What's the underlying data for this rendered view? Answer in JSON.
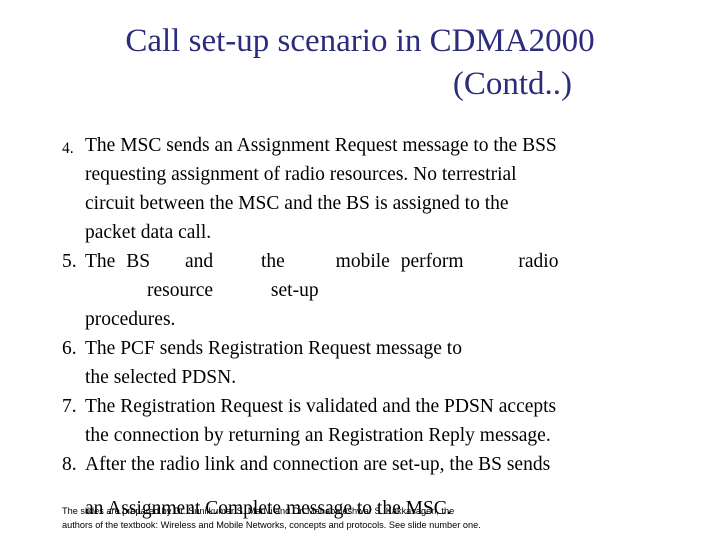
{
  "slide": {
    "title": {
      "line1": "Call set-up scenario in CDMA2000",
      "line2": "(Contd..)",
      "color": "#2c2c7c"
    },
    "items": [
      {
        "marker": "4.",
        "marker_style": "small",
        "lines": [
          "The MSC sends an Assignment Request message to the BSS",
          "requesting assignment of radio resources. No terrestrial",
          "circuit between the MSC and the BS is assigned to the",
          "packet data call."
        ],
        "full_text": "The MSC sends an Assignment Request message to the BSS requesting assignment of radio resources. No terrestrial circuit between the MSC and the BS is assigned to the packet data call."
      },
      {
        "marker": "5.",
        "marker_style": "normal",
        "line1_words": [
          "The",
          "BS",
          "and",
          "the",
          "mobile",
          "perform",
          "radio"
        ],
        "line2_words": [
          "resource",
          "set-up"
        ],
        "line3": "procedures.",
        "full_text": "The BS and the mobile perform radio resource set-up procedures."
      },
      {
        "marker": "6.",
        "marker_style": "normal",
        "lines": [
          "The PCF sends Registration Request message to",
          "the selected PDSN."
        ],
        "full_text": "The PCF sends Registration Request message to the selected PDSN."
      },
      {
        "marker": "7.",
        "marker_style": "normal",
        "lines": [
          "The Registration Request is validated and the PDSN accepts",
          "the connection by returning an Registration Reply message."
        ],
        "full_text": "The Registration Request is validated and the PDSN accepts the connection by returning an Registration Reply message."
      },
      {
        "marker": "8.",
        "marker_style": "normal",
        "lines": [
          "After the radio link and connection are set-up, the BS sends",
          "an Assignment Complete message to the MSC."
        ],
        "full_text": "After the radio link and connection are set-up, the BS sends an Assignment Complete message to the MSC."
      }
    ],
    "footer": {
      "line1": "The slides are prepared by Dr. Sunilkumar S. Manvi and Dr. Mahabaleshwar S. Kakkasageri, the",
      "line2": "authors of the textbook: Wireless and Mobile Networks, concepts and protocols. See slide number one."
    }
  }
}
